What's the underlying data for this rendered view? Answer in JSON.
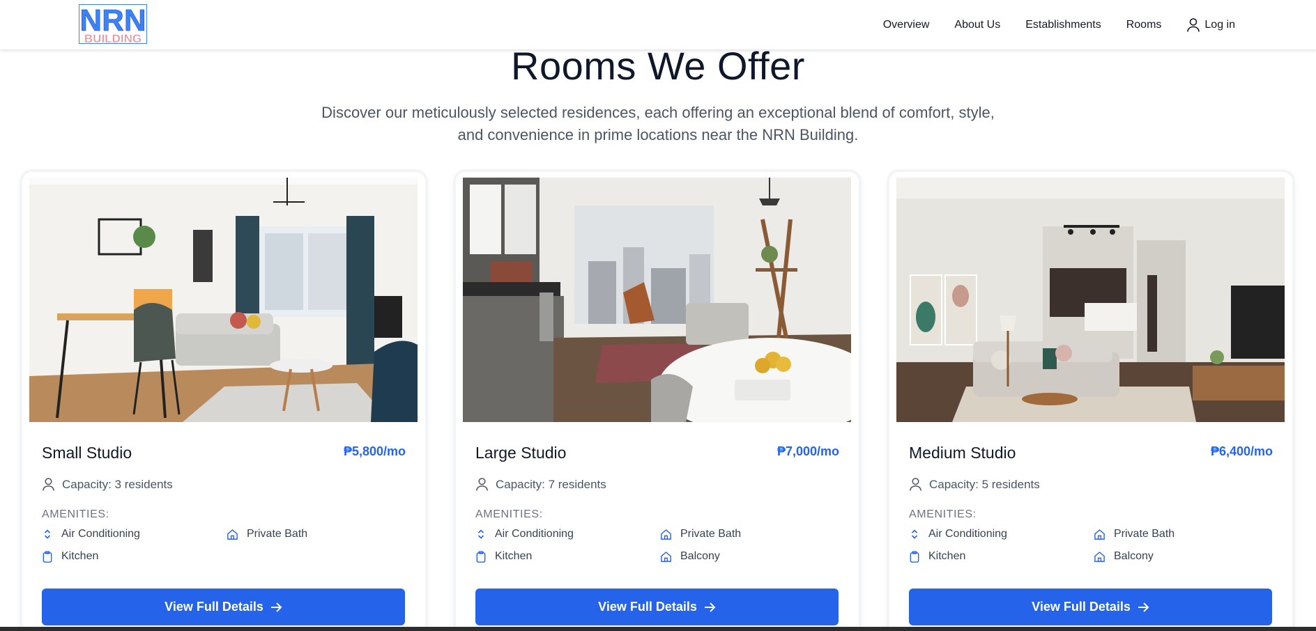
{
  "brand": {
    "logo_top": "NRN",
    "logo_bottom": "BUILDING",
    "top_color": "#3b82f6",
    "bottom_color": "#f28b96"
  },
  "nav": {
    "items": [
      "Overview",
      "About Us",
      "Establishments",
      "Rooms"
    ],
    "login_label": "Log in",
    "login_icon": "user-icon"
  },
  "section": {
    "title": "Rooms We Offer",
    "subtitle": "Discover our meticulously selected residences, each offering an exceptional blend of comfort, style, and convenience in prime locations near the NRN Building."
  },
  "amenities_heading": "AMENITIES:",
  "cta_label": "View Full Details",
  "cta_icon": "arrow-right-icon",
  "accent_color": "#2563eb",
  "rooms": [
    {
      "name": "Small Studio",
      "price": "₱5,800/mo",
      "capacity": "Capacity: 3 residents",
      "amenities": [
        {
          "label": "Air Conditioning",
          "icon": "chevrons-up-down-icon"
        },
        {
          "label": "Private Bath",
          "icon": "home-icon"
        },
        {
          "label": "Kitchen",
          "icon": "clipboard-icon"
        }
      ]
    },
    {
      "name": "Large Studio",
      "price": "₱7,000/mo",
      "capacity": "Capacity: 7 residents",
      "amenities": [
        {
          "label": "Air Conditioning",
          "icon": "chevrons-up-down-icon"
        },
        {
          "label": "Private Bath",
          "icon": "home-icon"
        },
        {
          "label": "Kitchen",
          "icon": "clipboard-icon"
        },
        {
          "label": "Balcony",
          "icon": "home-icon"
        }
      ]
    },
    {
      "name": "Medium Studio",
      "price": "₱6,400/mo",
      "capacity": "Capacity: 5 residents",
      "amenities": [
        {
          "label": "Air Conditioning",
          "icon": "chevrons-up-down-icon"
        },
        {
          "label": "Private Bath",
          "icon": "home-icon"
        },
        {
          "label": "Kitchen",
          "icon": "clipboard-icon"
        },
        {
          "label": "Balcony",
          "icon": "home-icon"
        }
      ]
    }
  ]
}
